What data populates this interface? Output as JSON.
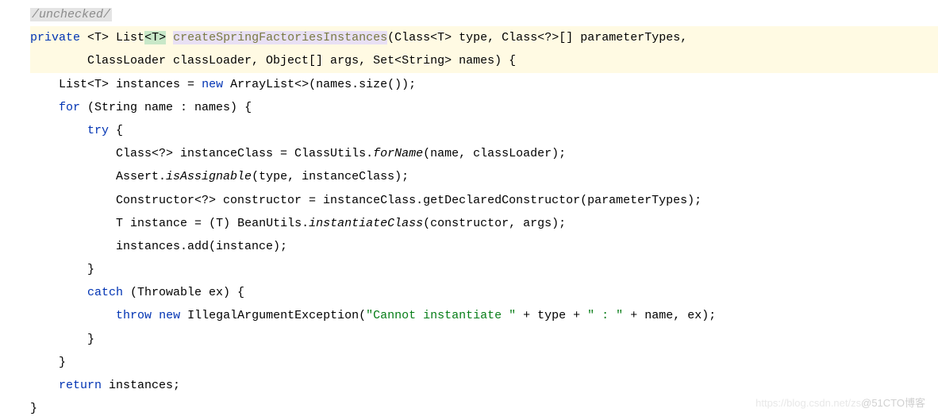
{
  "code": {
    "line1": {
      "comment": "/unchecked/"
    },
    "line2": {
      "kw_private": "private",
      "generic_open": " <",
      "T1": "T",
      "generic_mid": "> List",
      "T2": "<T>",
      "space": " ",
      "method": "createSpringFactoriesInstances",
      "params": "(Class<",
      "T3": "T",
      "params2": "> type, Class<?>[] parameterTypes,"
    },
    "line3": {
      "text": "        ClassLoader classLoader, Object[] args, Set<String> names) {"
    },
    "line4": {
      "indent": "    List<",
      "T": "T",
      "mid": "> instances = ",
      "kw_new": "new",
      "rest": " ArrayList<>(names.size());"
    },
    "line5": {
      "indent": "    ",
      "kw_for": "for",
      "rest": " (String name : names) {"
    },
    "line6": {
      "indent": "        ",
      "kw_try": "try",
      "rest": " {"
    },
    "line7": {
      "indent": "            Class<?> instanceClass = ClassUtils.",
      "static": "forName",
      "rest": "(name, classLoader);"
    },
    "line8": {
      "indent": "            Assert.",
      "static": "isAssignable",
      "rest": "(type, instanceClass);"
    },
    "line9": {
      "indent": "            Constructor<?> constructor = instanceClass.getDeclaredConstructor(parameterTypes);"
    },
    "line10": {
      "indent": "            ",
      "T": "T",
      "mid": " instance = (",
      "T2": "T",
      "mid2": ") BeanUtils.",
      "static": "instantiateClass",
      "rest": "(constructor, args);"
    },
    "line11": {
      "indent": "            instances.add(instance);"
    },
    "line12": {
      "indent": "        }"
    },
    "line13": {
      "indent": "        ",
      "kw_catch": "catch",
      "rest": " (Throwable ex) {"
    },
    "line14": {
      "indent": "            ",
      "kw_throw": "throw",
      "space": " ",
      "kw_new": "new",
      "mid": " IllegalArgumentException(",
      "str1": "\"Cannot instantiate \"",
      "mid2": " + type + ",
      "str2": "\" : \"",
      "rest": " + name, ex);"
    },
    "line15": {
      "indent": "        }"
    },
    "line16": {
      "indent": "    }"
    },
    "line17": {
      "indent": "    ",
      "kw_return": "return",
      "rest": " instances;"
    },
    "line18": {
      "indent": "}"
    }
  },
  "watermark": {
    "faint": "https://blog.csdn.net/zs",
    "text": "@51CTO博客"
  }
}
